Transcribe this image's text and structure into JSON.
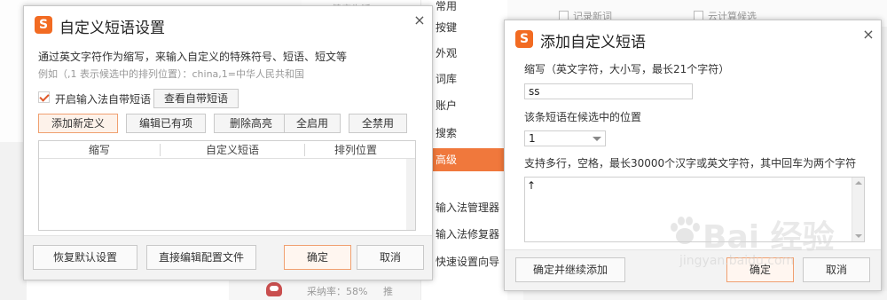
{
  "background": {
    "top_strip_text": "健康生活",
    "settings_nav": [
      {
        "label": "常用",
        "active": false
      },
      {
        "label": "按键",
        "active": false
      },
      {
        "label": "外观",
        "active": false
      },
      {
        "label": "词库",
        "active": false
      },
      {
        "label": "账户",
        "active": false
      },
      {
        "label": "搜索",
        "active": false
      },
      {
        "label": "高级",
        "active": true
      },
      {
        "label": "输入法管理器",
        "active": false
      },
      {
        "label": "输入法修复器",
        "active": false
      },
      {
        "label": "快速设置向导",
        "active": false
      }
    ],
    "top_right_options": [
      "记录新词",
      "云计算候选"
    ],
    "rate_label": "采纳率：58%",
    "rate_cut": "推"
  },
  "left_dialog": {
    "title": "自定义短语设置",
    "close": "×",
    "description": "通过英文字符作为缩写，来输入自定义的特殊符号、短语、短文等",
    "example": "例如（,1 表示候选中的排列位置）：china,1=中华人民共和国",
    "enable_label": "开启输入法自带短语",
    "view_builtin_button": "查看自带短语",
    "toolbar": {
      "add": "添加新定义",
      "edit": "编辑已有项",
      "delete": "删除高亮",
      "enable_all": "全启用",
      "disable_all": "全禁用"
    },
    "table_headers": [
      "缩写",
      "自定义短语",
      "排列位置"
    ],
    "footer": {
      "restore": "恢复默认设置",
      "edit_config": "直接编辑配置文件",
      "ok": "确定",
      "cancel": "取消"
    }
  },
  "right_dialog": {
    "title": "添加自定义短语",
    "close": "×",
    "abbr_label": "缩写（英文字符，大小写，最长21个字符）",
    "abbr_value": "ss",
    "position_label": "该条短语在候选中的位置",
    "position_value": "1",
    "content_label": "支持多行，空格，最长30000个汉字或英文字符，其中回车为两个字符",
    "content_value": "↑",
    "footer": {
      "ok_continue": "确定并继续添加",
      "ok": "确定",
      "cancel": "取消"
    }
  },
  "watermark": {
    "text": "Bai 经验",
    "sub": "jingyan.baidu.com"
  },
  "colors": {
    "accent": "#f0783c",
    "logo": "#f26b22"
  }
}
